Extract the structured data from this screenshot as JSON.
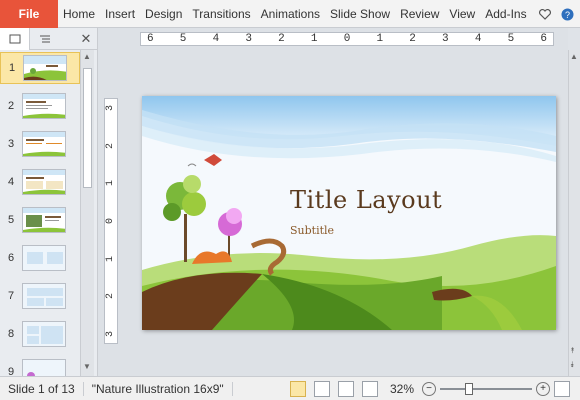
{
  "ribbon": {
    "file_label": "File",
    "tabs": [
      "Home",
      "Insert",
      "Design",
      "Transitions",
      "Animations",
      "Slide Show",
      "Review",
      "View",
      "Add-Ins"
    ],
    "icons": [
      "heart-icon",
      "help-icon"
    ]
  },
  "pane": {
    "close_label": "✕",
    "slides": [
      {
        "num": "1",
        "selected": true
      },
      {
        "num": "2"
      },
      {
        "num": "3"
      },
      {
        "num": "4"
      },
      {
        "num": "5"
      },
      {
        "num": "6"
      },
      {
        "num": "7"
      },
      {
        "num": "8"
      },
      {
        "num": "9"
      }
    ]
  },
  "ruler": {
    "h_labels": [
      "6",
      "5",
      "4",
      "3",
      "2",
      "1",
      "0",
      "1",
      "2",
      "3",
      "4",
      "5",
      "6"
    ],
    "v_labels": [
      "3",
      "2",
      "1",
      "0",
      "1",
      "2",
      "3"
    ]
  },
  "slide": {
    "title": "Title Layout",
    "subtitle": "Subtitle"
  },
  "status": {
    "slide_info": "Slide 1 of 13",
    "theme": "\"Nature Illustration 16x9\"",
    "zoom": "32%",
    "zoom_level": 0.32
  },
  "colors": {
    "file_tab": "#e8543a",
    "title_text": "#5a3a1e",
    "sky": "#a9d2f0",
    "grass_light": "#9ccb3d",
    "grass_dark": "#5c8f22",
    "soil": "#6b3d1c"
  }
}
